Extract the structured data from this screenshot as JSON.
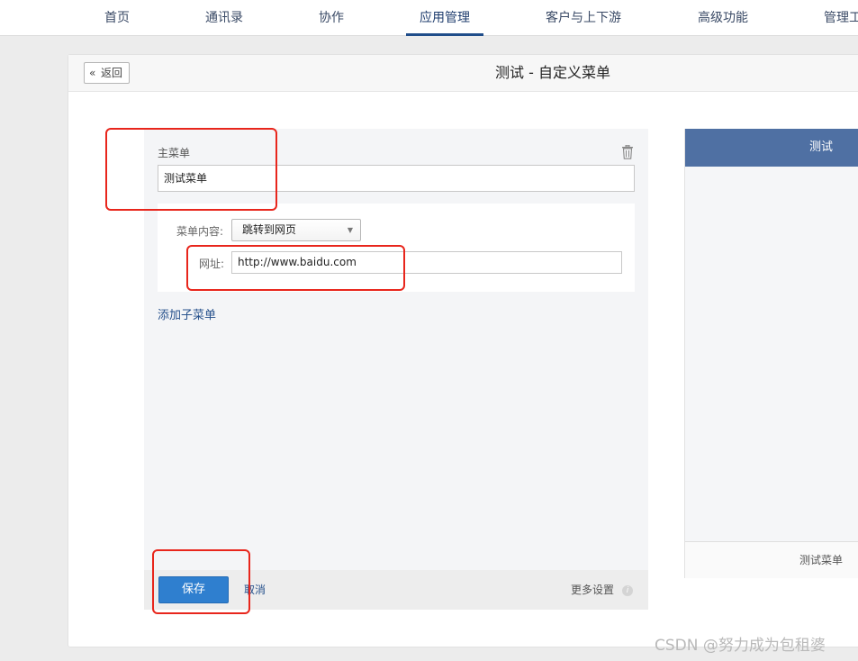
{
  "nav": {
    "items": [
      {
        "label": "首页"
      },
      {
        "label": "通讯录"
      },
      {
        "label": "协作"
      },
      {
        "label": "应用管理",
        "active": true
      },
      {
        "label": "客户与上下游"
      },
      {
        "label": "高级功能"
      },
      {
        "label": "管理工"
      }
    ]
  },
  "header": {
    "back_label": "返回",
    "back_icon": "double-chevron-left-icon",
    "title": "测试 - 自定义菜单"
  },
  "editor": {
    "menu_label": "主菜单",
    "menu_name_value": "测试菜单",
    "content_label": "菜单内容:",
    "content_select_value": "跳转到网页",
    "url_label": "网址:",
    "url_value": "http://www.baidu.com",
    "add_submenu": "添加子菜单",
    "save": "保存",
    "cancel": "取消",
    "more_settings": "更多设置",
    "trash_icon": "trash-icon",
    "info_icon": "info-icon"
  },
  "preview": {
    "title": "测试",
    "bottom_menu": "测试菜单"
  },
  "watermark": "CSDN @努力成为包租婆",
  "colors": {
    "accent_blue": "#2f7fcf",
    "preview_header": "#4f70a3",
    "annotation_red": "#e8261c",
    "link_blue": "#26518c"
  }
}
